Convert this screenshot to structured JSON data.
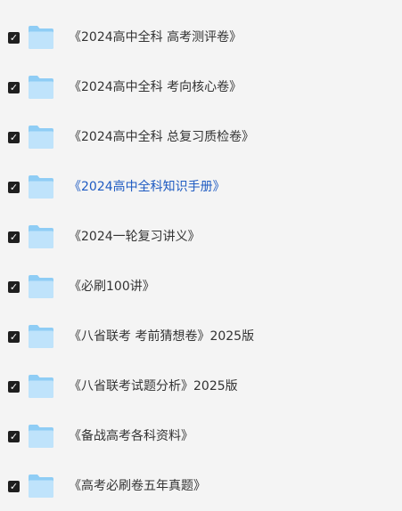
{
  "icons": {
    "checkbox": "checkmark-checkbox",
    "folder": "folder-icon"
  },
  "colors": {
    "background": "#f4f4f4",
    "text": "#333333",
    "link_text": "#1f5bc2",
    "checkbox": "#1f1f1f",
    "folder_back": "#8fcdf5",
    "folder_front": "#bfe3fb"
  },
  "file_list": {
    "items": [
      {
        "name": "《2024高中全科 高考测评卷》",
        "checked": true,
        "highlight": false
      },
      {
        "name": "《2024高中全科 考向核心卷》",
        "checked": true,
        "highlight": false
      },
      {
        "name": "《2024高中全科 总复习质检卷》",
        "checked": true,
        "highlight": false
      },
      {
        "name": "《2024高中全科知识手册》",
        "checked": true,
        "highlight": true
      },
      {
        "name": "《2024一轮复习讲义》",
        "checked": true,
        "highlight": false
      },
      {
        "name": "《必刷100讲》",
        "checked": true,
        "highlight": false
      },
      {
        "name": "《八省联考 考前猜想卷》2025版",
        "checked": true,
        "highlight": false
      },
      {
        "name": "《八省联考试题分析》2025版",
        "checked": true,
        "highlight": false
      },
      {
        "name": "《备战高考各科资料》",
        "checked": true,
        "highlight": false
      },
      {
        "name": "《高考必刷卷五年真题》",
        "checked": true,
        "highlight": false
      }
    ]
  }
}
